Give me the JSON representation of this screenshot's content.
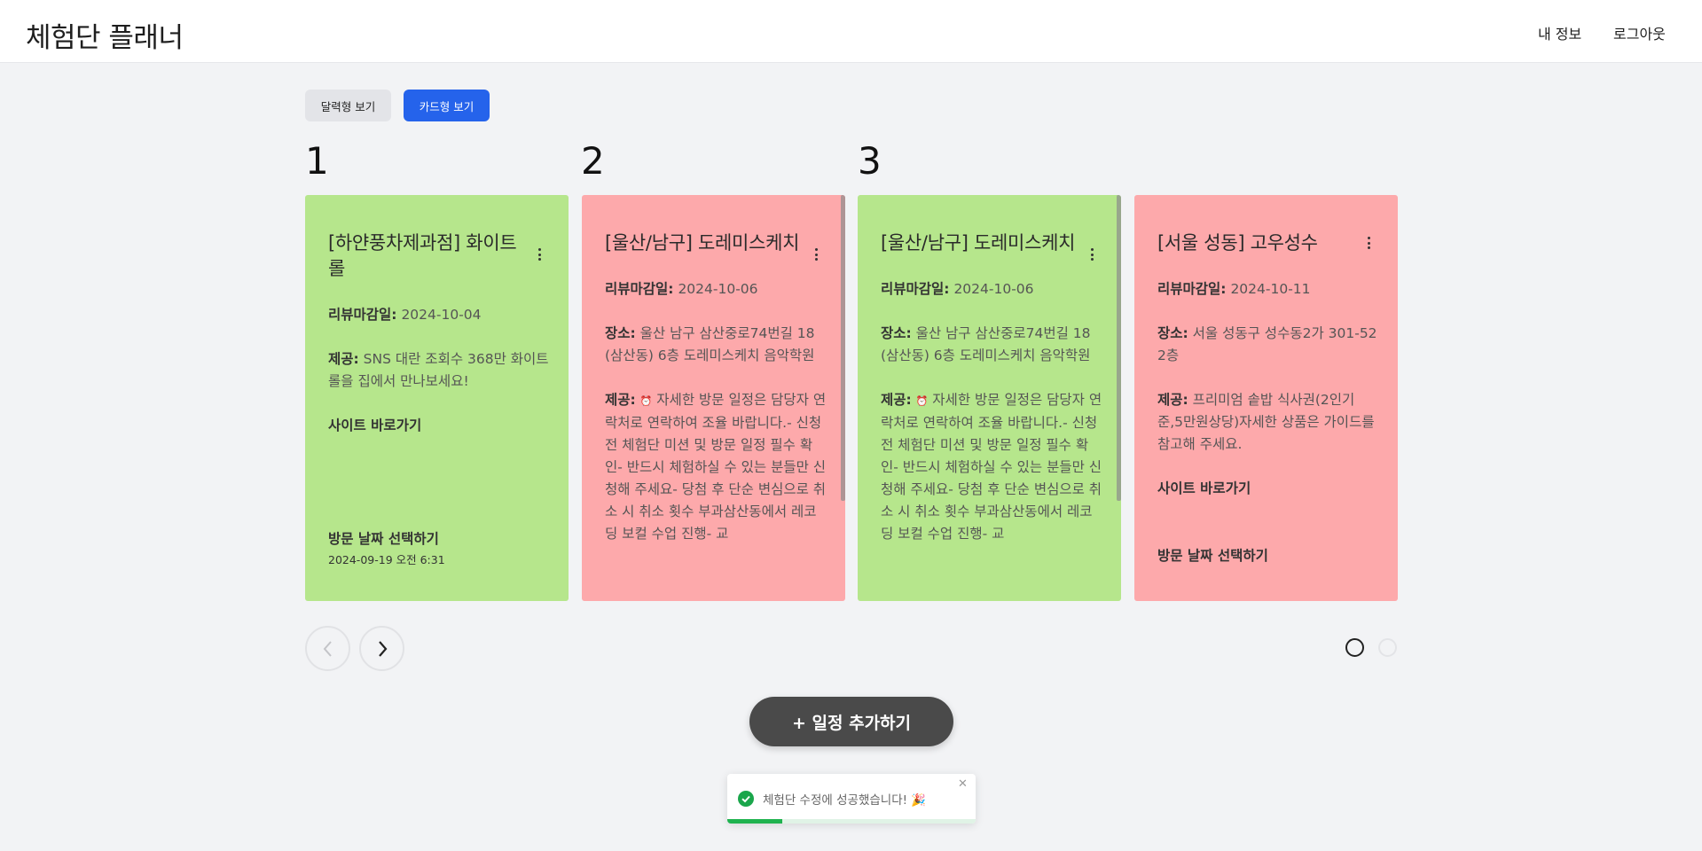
{
  "header": {
    "title": "체험단 플래너",
    "my_info": "내 정보",
    "logout": "로그아웃"
  },
  "view_toggle": {
    "calendar_label": "달력형 보기",
    "card_label": "카드형 보기",
    "active": "카드형 보기"
  },
  "columns": [
    "1",
    "2",
    "3"
  ],
  "cards": [
    {
      "color": "#b6e68c",
      "title": "[하얀풍차제과점] 화이트롤",
      "deadline_label": "리뷰마감일:",
      "deadline": "2024-10-04",
      "offer_label": "제공:",
      "offer": "SNS 대란 조회수 368만 화이트롤을 집에서 만나보세요!",
      "site_link": "사이트 바로가기",
      "visit_select": "방문 날짜 선택하기",
      "visit_date": "2024-09-19 오전 6:31"
    },
    {
      "color": "#fda9ab",
      "title": "[울산/남구] 도레미스케치",
      "deadline_label": "리뷰마감일:",
      "deadline": "2024-10-06",
      "place_label": "장소:",
      "place": "울산 남구 삼산중로74번길 18 (삼산동) 6층 도레미스케치 음악학원",
      "offer_label": "제공:",
      "offer": "자세한 방문 일정은 담당자 연락처로 연락하여 조율 바랍니다.- 신청 전 체험단 미션 및 방문 일정 필수 확인- 반드시 체험하실 수 있는 분들만 신청해 주세요- 당첨 후 단순 변심으로 취소 시 취소 횟수 부과삼산동에서 레코딩 보컬 수업 진행- 교"
    },
    {
      "color": "#b6e68c",
      "title": "[울산/남구] 도레미스케치",
      "deadline_label": "리뷰마감일:",
      "deadline": "2024-10-06",
      "place_label": "장소:",
      "place": "울산 남구 삼산중로74번길 18 (삼산동) 6층 도레미스케치 음악학원",
      "offer_label": "제공:",
      "offer": "자세한 방문 일정은 담당자 연락처로 연락하여 조율 바랍니다.- 신청 전 체험단 미션 및 방문 일정 필수 확인- 반드시 체험하실 수 있는 분들만 신청해 주세요- 당첨 후 단순 변심으로 취소 시 취소 횟수 부과삼산동에서 레코딩 보컬 수업 진행- 교"
    },
    {
      "color": "#fda9ab",
      "title": "[서울 성동] 고우성수",
      "deadline_label": "리뷰마감일:",
      "deadline": "2024-10-11",
      "place_label": "장소:",
      "place": "서울 성동구 성수동2가 301-52 2층",
      "offer_label": "제공:",
      "offer": "프리미엄 솥밥 식사권(2인기준,5만원상당)자세한 상품은 가이드를 참고해 주세요.",
      "site_link": "사이트 바로가기",
      "visit_select": "방문 날짜 선택하기"
    }
  ],
  "pagination": {
    "pages": 2,
    "current": 1
  },
  "add_button": "+ 일정 추가하기",
  "toast": {
    "message": "체험단 수정에 성공했습니다! 🎉",
    "close": "✕",
    "progress": 0.22,
    "color": "#1fb34f"
  }
}
